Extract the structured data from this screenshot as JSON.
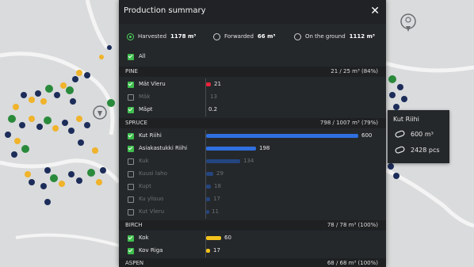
{
  "panel": {
    "title": "Production summary",
    "close_icon": "close-icon",
    "modes": [
      {
        "label": "Harvested",
        "value": "1178 m³",
        "selected": true
      },
      {
        "label": "Forwarded",
        "value": "66 m³",
        "selected": false
      },
      {
        "label": "On the ground",
        "value": "1112 m³",
        "selected": false
      }
    ],
    "all_label": "All",
    "sections": [
      {
        "name": "PINE",
        "summary": "21 / 25 m³ (84%)",
        "rows": [
          {
            "label": "Mät Vleru",
            "value": "21",
            "checked": true
          },
          {
            "label": "Mäk",
            "value": "13",
            "checked": false
          },
          {
            "label": "Mäpt",
            "value": "0.2",
            "checked": true
          }
        ]
      },
      {
        "name": "SPRUCE",
        "summary": "798 / 1007 m³ (79%)",
        "rows": [
          {
            "label": "Kut Riihi",
            "value": "600",
            "checked": true
          },
          {
            "label": "Asiakastukki Riihi",
            "value": "198",
            "checked": true
          },
          {
            "label": "Kuk",
            "value": "134",
            "checked": false
          },
          {
            "label": "Kuusi laho",
            "value": "29",
            "checked": false
          },
          {
            "label": "Kupt",
            "value": "18",
            "checked": false
          },
          {
            "label": "Ku ylisuo",
            "value": "17",
            "checked": false
          },
          {
            "label": "Kut Vleru",
            "value": "11",
            "checked": false
          }
        ]
      },
      {
        "name": "BIRCH",
        "summary": "78 / 78 m³ (100%)",
        "rows": [
          {
            "label": "Kok",
            "value": "60",
            "checked": true
          },
          {
            "label": "Kov Riga",
            "value": "17",
            "checked": true
          }
        ]
      },
      {
        "name": "ASPEN",
        "summary": "68 / 68 m³ (100%)",
        "rows": []
      }
    ],
    "colors": {
      "pine": "#e8233a",
      "spruce": "#2f6fe0",
      "birch": "#f3c21d",
      "checkbox": "#3fbf4d"
    }
  },
  "tooltip": {
    "title": "Kut Riihi",
    "volume": "600 m³",
    "pieces": "2428 pcs",
    "volume_icon": "log-icon",
    "pieces_icon": "logs-icon"
  },
  "map": {
    "location_pin_icon": "location-pin-icon",
    "marker_icon": "map-marker-icon"
  }
}
